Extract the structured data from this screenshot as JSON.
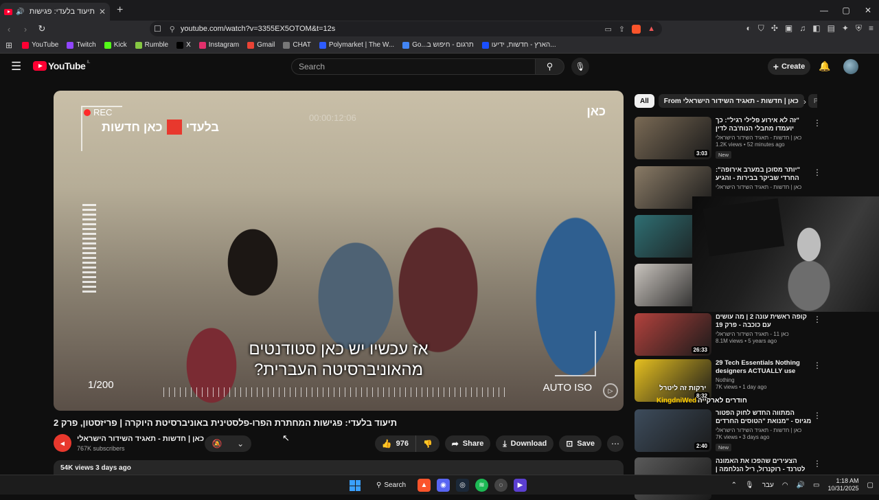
{
  "browser": {
    "tab_title": "תיעוד בלעדי: פגישות המחתרת",
    "url": "youtube.com/watch?v=3355EX5OTOM&t=12s",
    "window_controls": {
      "minimize": "—",
      "maximize": "▢",
      "close": "✕"
    }
  },
  "bookmarks": [
    {
      "label": "YouTube",
      "color": "#ff0033"
    },
    {
      "label": "Twitch",
      "color": "#9146ff"
    },
    {
      "label": "Kick",
      "color": "#53fc18"
    },
    {
      "label": "Rumble",
      "color": "#85c742"
    },
    {
      "label": "X",
      "color": "#000000"
    },
    {
      "label": "Instagram",
      "color": "#e1306c"
    },
    {
      "label": "Gmail",
      "color": "#ea4335"
    },
    {
      "label": "CHAT",
      "color": "#777777"
    },
    {
      "label": "Polymarket | The W...",
      "color": "#2e5cff"
    },
    {
      "label": "Go...תרגום - חיפוש ב",
      "color": "#4285f4"
    },
    {
      "label": "הארץ - חדשות, ידיעו...",
      "color": "#1a4fff"
    }
  ],
  "youtube": {
    "logo_word": "YouTube",
    "region": "IL",
    "search_placeholder": "Search",
    "create_label": "Create"
  },
  "video": {
    "rec_label": "REC",
    "overlay_brand": "בלעדי",
    "overlay_channel": "כאן חדשות",
    "corner_logo": "כאן",
    "ghost_time": "00:00:12:06",
    "subtitle_line1": "אז עכשיו יש כאן סטודנטים",
    "subtitle_line2": "מהאוניברסיטה העברית?",
    "frame_count": "1/200",
    "auto_iso": "AUTO ISO",
    "title": "תיעוד בלעדי: פגישות המחתרת הפרו-פלסטינית באוניברסיטת היוקרה | פריזסטון, פרק 2",
    "channel_name": "כאן | חדשות - תאגיד השידור הישראלי",
    "subscribers": "767K subscribers",
    "likes": "976",
    "share_label": "Share",
    "download_label": "Download",
    "save_label": "Save",
    "views_date": "54K views  3 days ago"
  },
  "sidebar": {
    "chips": [
      {
        "label": "All",
        "active": true
      },
      {
        "label": "From כאן | חדשות - תאגיד השידור הישראלי",
        "active": false
      },
      {
        "label": "Po",
        "active": false
      }
    ],
    "items": [
      {
        "title": "\"זה לא אירוע פלילי רגיל\": כך יועמדו מחבלי הנוח'בה לדין",
        "channel": "כאן | חדשות - תאגיד השידור הישראלי",
        "meta": "1.2K views • 52 minutes ago",
        "badge": "New",
        "duration": "3:03",
        "thumb": "#7a6a55"
      },
      {
        "title": "\"יותר מסוכן במערב אירופה\": החרדי שביקר בבירות - והגיע ללב הדאחייה",
        "channel": "כאן | חדשות - תאגיד השידור הישראלי",
        "meta": "",
        "badge": "",
        "duration": "",
        "thumb": "#8a7b66"
      },
      {
        "title": "",
        "channel": "",
        "meta": "",
        "badge": "",
        "duration": "",
        "thumb": "#2f6f73"
      },
      {
        "title": "",
        "channel": "",
        "meta": "",
        "badge": "",
        "duration": "",
        "thumb": "#c9c4be"
      },
      {
        "title": "קופה ראשית עונה 2 | מה עושים עם כוכבה - פרק 19",
        "channel": "כאן 11 - תאגיד השידור הישראלי",
        "meta": "8.1M views • 5 years ago",
        "badge": "",
        "duration": "26:33",
        "thumb": "#b3423d"
      },
      {
        "title": "29 Tech Essentials Nothing designers ACTUALLY use",
        "channel": "Nothing",
        "meta": "7K views • 1 day ago",
        "badge": "",
        "duration": "8:32",
        "thumb": "#e6c020"
      },
      {
        "title": "המתווה החדש לחוק הפטור מגיוס - \"מנואת \"הטוסים החרדים ...",
        "channel": "כאן | חדשות - תאגיד השידור הישראלי",
        "meta": "7K views • 3 days ago",
        "badge": "New",
        "duration": "2:40",
        "thumb": "#3d4c5c"
      },
      {
        "title": "הצעירים שהפכו את האמונה לטרנד - רוקנרול, ריל הנלחמה | אלונית",
        "channel": "",
        "meta": "",
        "badge": "",
        "duration": "",
        "thumb": "#5a5a5a"
      }
    ],
    "overlay_caption_1": "ירקות זה ליטרל",
    "overlay_caption_2": "חודרים לארקייה",
    "overlay_tag": "KingdniWed"
  },
  "taskbar": {
    "search_label": "Search",
    "lang": "עבר",
    "time": "1:18 AM",
    "date": "10/31/2025"
  }
}
